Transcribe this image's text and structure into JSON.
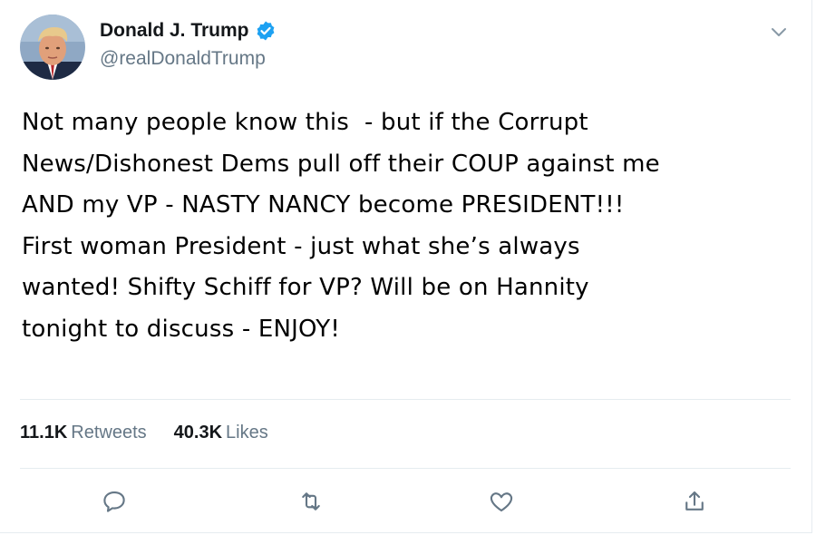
{
  "author": {
    "display_name": "Donald J. Trump",
    "handle": "@realDonaldTrump",
    "verified": true
  },
  "tweet": {
    "lines": [
      "Not many people know this  - but if the Corrupt",
      "News/Dishonest Dems pull off their COUP against me",
      "AND my VP - NASTY NANCY become PRESIDENT!!!",
      "First woman President - just what she’s always",
      "wanted! Shifty Schiff for VP? Will be on Hannity",
      "tonight to discuss - ENJOY!"
    ]
  },
  "stats": {
    "retweets_count": "11.1K",
    "retweets_label": "Retweets",
    "likes_count": "40.3K",
    "likes_label": "Likes"
  },
  "actions": [
    "reply-icon",
    "retweet-icon",
    "like-icon",
    "share-icon"
  ],
  "colors": {
    "text": "#14171a",
    "secondary": "#657786",
    "verified": "#1da1f2",
    "divider": "#e6ecf0"
  }
}
